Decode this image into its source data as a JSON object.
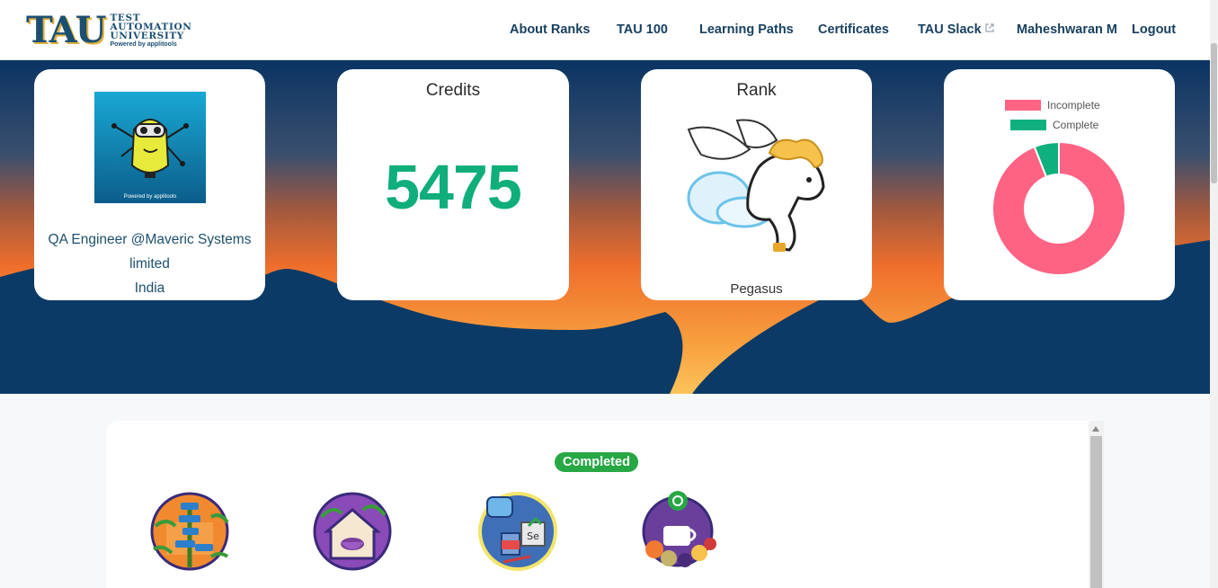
{
  "brand": {
    "logo_mark": "TAU",
    "line1": "TEST",
    "line2": "AUTOMATION",
    "line3": "UNIVERSITY",
    "powered": "Powered by applitools"
  },
  "nav": {
    "about_ranks": "About Ranks",
    "tau_100": "TAU 100",
    "learning_paths": "Learning Paths",
    "certificates": "Certificates",
    "tau_slack": "TAU Slack",
    "user": "Maheshwaran M",
    "logout": "Logout"
  },
  "profile": {
    "avatar_powered": "Powered by applitools",
    "title_line1": "QA Engineer @Maveric Systems",
    "title_line2": "limited",
    "country": "India"
  },
  "credits": {
    "title": "Credits",
    "value": "5475"
  },
  "rank": {
    "title": "Rank",
    "name": "Pegasus",
    "icon": "pegasus-icon"
  },
  "progress": {
    "legend": [
      {
        "label": "Incomplete",
        "color": "#ff6384"
      },
      {
        "label": "Complete",
        "color": "#0fb07e"
      }
    ]
  },
  "chart_data": {
    "type": "pie",
    "variant": "doughnut",
    "labels": [
      "Incomplete",
      "Complete"
    ],
    "values": [
      94,
      6
    ],
    "colors": [
      "#ff6384",
      "#0fb07e"
    ],
    "legend_position": "top"
  },
  "completed": {
    "label": "Completed",
    "badges": [
      "code-tree-badge-icon",
      "tea-house-badge-icon",
      "robot-selenium-badge-icon",
      "cucumber-coffee-badge-icon"
    ]
  },
  "colors": {
    "nav_text": "#173f5f",
    "accent_green": "#0fae7a",
    "badge_green": "#28a745",
    "hero_navy": "#0b3a66",
    "sunset_orange": "#f47a2d"
  }
}
